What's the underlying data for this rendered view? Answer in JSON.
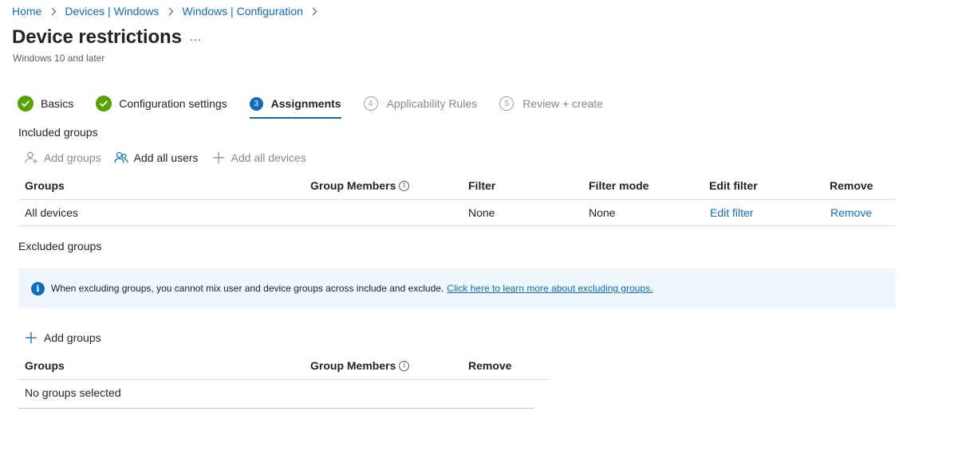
{
  "breadcrumb": {
    "items": [
      "Home",
      "Devices | Windows",
      "Windows | Configuration"
    ]
  },
  "page": {
    "title": "Device restrictions",
    "more": "...",
    "subtitle": "Windows 10 and later"
  },
  "steps": [
    {
      "label": "Basics",
      "state": "done",
      "number": "1"
    },
    {
      "label": "Configuration settings",
      "state": "done",
      "number": "2"
    },
    {
      "label": "Assignments",
      "state": "current",
      "number": "3"
    },
    {
      "label": "Applicability Rules",
      "state": "future",
      "number": "4"
    },
    {
      "label": "Review + create",
      "state": "future",
      "number": "5"
    }
  ],
  "included": {
    "heading": "Included groups",
    "commands": {
      "add_groups": "Add groups",
      "add_all_users": "Add all users",
      "add_all_devices": "Add all devices"
    },
    "columns": {
      "groups": "Groups",
      "group_members": "Group Members",
      "filter": "Filter",
      "filter_mode": "Filter mode",
      "edit_filter": "Edit filter",
      "remove": "Remove"
    },
    "rows": [
      {
        "group": "All devices",
        "filter": "None",
        "filter_mode": "None",
        "edit_filter": "Edit filter",
        "remove": "Remove"
      }
    ]
  },
  "excluded": {
    "heading": "Excluded groups",
    "banner_text": "When excluding groups, you cannot mix user and device groups across include and exclude.",
    "banner_link": "Click here to learn more about excluding groups.",
    "add_groups": "Add groups",
    "columns": {
      "groups": "Groups",
      "group_members": "Group Members",
      "remove": "Remove"
    },
    "empty_text": "No groups selected"
  },
  "colors": {
    "accent": "#0f6cbd",
    "success": "#57a300",
    "banner_bg": "#eff6fc"
  }
}
